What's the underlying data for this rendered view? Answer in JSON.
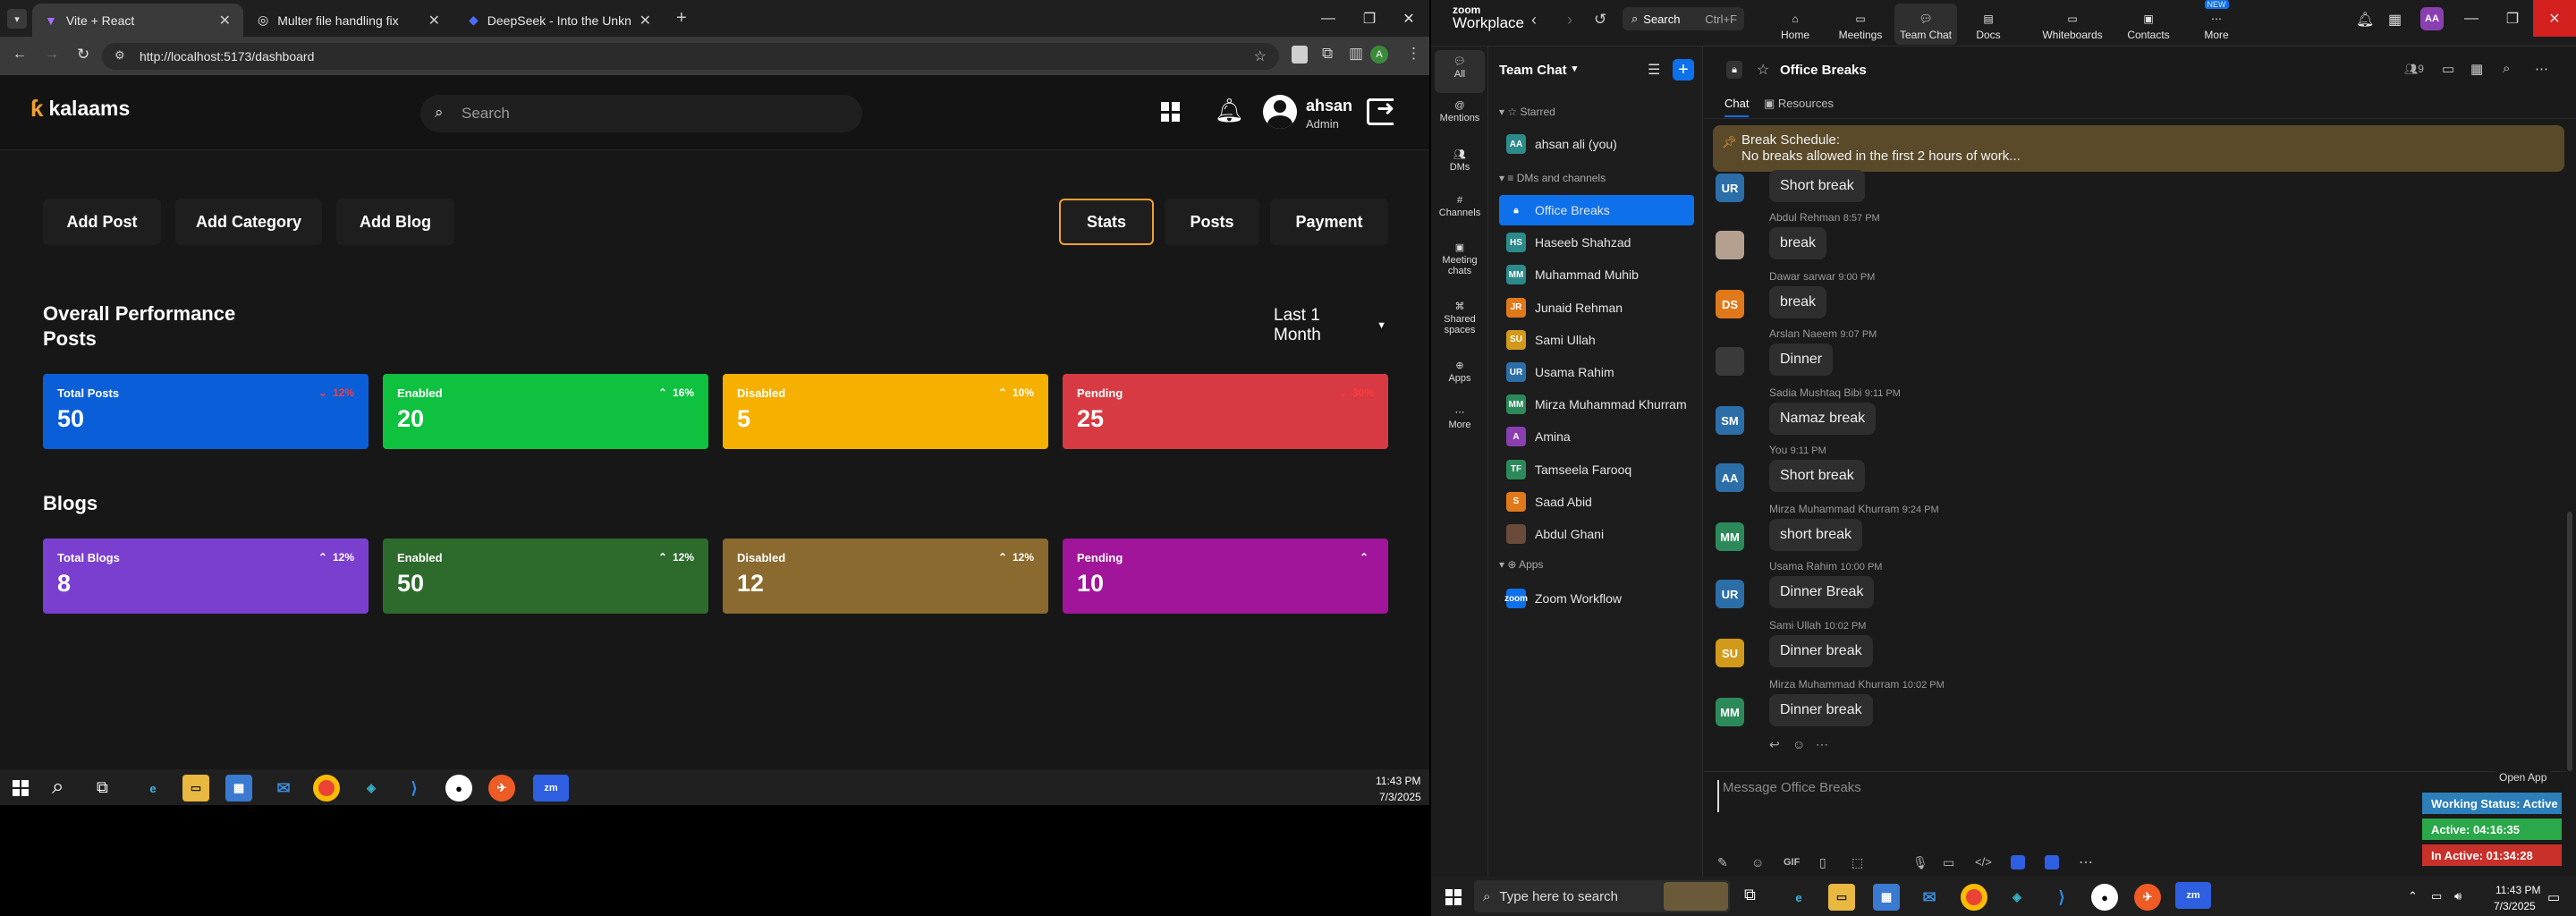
{
  "browser": {
    "tabs": [
      {
        "title": "Vite + React"
      },
      {
        "title": "Multer file handling fix"
      },
      {
        "title": "DeepSeek - Into the Unknown"
      }
    ],
    "url": "http://localhost:5173/dashboard"
  },
  "dashboard": {
    "logo": "kalaams",
    "search_placeholder": "Search",
    "user": {
      "name": "ahsan",
      "role": "Admin"
    },
    "nav_left": [
      "Add Post",
      "Add Category",
      "Add Blog"
    ],
    "nav_right": [
      "Stats",
      "Posts",
      "Payment"
    ],
    "section_title": "Overall Performance",
    "posts_title": "Posts",
    "range": "Last 1 Month",
    "post_cards": [
      {
        "label": "Total Posts",
        "value": "50",
        "change": "12%",
        "color": "#0a5fd8",
        "change_color": "#ff3b3b",
        "up": false
      },
      {
        "label": "Enabled",
        "value": "20",
        "change": "16%",
        "color": "#0ec13f",
        "change_color": "#ffffff",
        "up": true
      },
      {
        "label": "Disabled",
        "value": "5",
        "change": "10%",
        "color": "#f5b000",
        "change_color": "#ffffff",
        "up": true
      },
      {
        "label": "Pending",
        "value": "25",
        "change": "30%",
        "color": "#d83a44",
        "change_color": "#ff3b3b",
        "up": false
      }
    ],
    "blogs_title": "Blogs",
    "blog_cards": [
      {
        "label": "Total Blogs",
        "value": "8",
        "change": "12%",
        "color": "#7b3fd0",
        "change_color": "#ffffff",
        "up": true
      },
      {
        "label": "Enabled",
        "value": "50",
        "change": "12%",
        "color": "#2d6b2d",
        "change_color": "#ffffff",
        "up": true
      },
      {
        "label": "Disabled",
        "value": "12",
        "change": "12%",
        "color": "#8a6a2e",
        "change_color": "#ffffff",
        "up": true
      },
      {
        "label": "Pending",
        "value": "10",
        "change": "",
        "color": "#a0159a",
        "change_color": "#ffffff",
        "up": true
      }
    ],
    "taskbar_time": "11:43 PM",
    "taskbar_date": "7/3/2025"
  },
  "zoom": {
    "brand_top": "zoom",
    "brand": "Workplace",
    "search_label": "Search",
    "search_shortcut": "Ctrl+F",
    "top_tabs": [
      "Home",
      "Meetings",
      "Team Chat",
      "Docs",
      "Whiteboards",
      "Contacts",
      "More"
    ],
    "new_badge": "NEW",
    "user_initials": "AA",
    "rail": [
      "All",
      "Mentions",
      "DMs",
      "Channels",
      "Meeting chats",
      "Shared spaces",
      "Apps",
      "More"
    ],
    "list_title": "Team Chat",
    "starred_label": "Starred",
    "starred": [
      {
        "name": "ahsan ali (you)",
        "initials": "AA",
        "color": "#2c8a8a"
      }
    ],
    "dm_label": "DMs and channels",
    "dms": [
      {
        "name": "Office Breaks",
        "initials": "",
        "color": "#0e71eb"
      },
      {
        "name": "Haseeb Shahzad",
        "initials": "HS",
        "color": "#2c8a8a"
      },
      {
        "name": "Muhammad Muhib",
        "initials": "MM",
        "color": "#2c8a8a"
      },
      {
        "name": "Junaid Rehman",
        "initials": "JR",
        "color": "#e0791a"
      },
      {
        "name": "Sami Ullah",
        "initials": "SU",
        "color": "#d19a1a"
      },
      {
        "name": "Usama Rahim",
        "initials": "UR",
        "color": "#2c6fa8"
      },
      {
        "name": "Mirza Muhammad Khurram",
        "initials": "MM",
        "color": "#2c8a5a"
      },
      {
        "name": "Amina",
        "initials": "A",
        "color": "#8a3fb0"
      },
      {
        "name": "Tamseela Farooq",
        "initials": "TF",
        "color": "#2c8a5a"
      },
      {
        "name": "Saad Abid",
        "initials": "S",
        "color": "#e0791a"
      },
      {
        "name": "Abdul Ghani",
        "initials": "",
        "color": "#6a4a3a"
      }
    ],
    "apps_label": "Apps",
    "apps": [
      {
        "name": "Zoom Workflow",
        "initials": "zoom",
        "color": "#0e71eb"
      }
    ],
    "channel": "Office Breaks",
    "channel_tabs": [
      "Chat",
      "Resources"
    ],
    "member_count": "9",
    "pinned_title": "Break Schedule:",
    "pinned_text": "No breaks allowed in the first 2 hours of work...",
    "messages": [
      {
        "author": "",
        "time": "",
        "text": "Short break",
        "initials": "UR",
        "color": "#2c6fa8"
      },
      {
        "author": "Abdul Rehman",
        "time": "8:57 PM",
        "text": "break",
        "initials": "",
        "color": "#b5a090"
      },
      {
        "author": "Dawar sarwar",
        "time": "9:00 PM",
        "text": "break",
        "initials": "DS",
        "color": "#e0791a"
      },
      {
        "author": "Arslan Naeem",
        "time": "9:07 PM",
        "text": "Dinner",
        "initials": "",
        "color": "#3a3a3a"
      },
      {
        "author": "Sadia Mushtaq Bibi",
        "time": "9:11 PM",
        "text": "Namaz break",
        "initials": "SM",
        "color": "#2c6fa8"
      },
      {
        "author": "You",
        "time": "9:11 PM",
        "text": "Short break",
        "initials": "AA",
        "color": "#2c6fa8"
      },
      {
        "author": "Mirza Muhammad Khurram",
        "time": "9:24 PM",
        "text": "short break",
        "initials": "MM",
        "color": "#2c8a5a"
      },
      {
        "author": "Usama Rahim",
        "time": "10:00 PM",
        "text": "Dinner Break",
        "initials": "UR",
        "color": "#2c6fa8"
      },
      {
        "author": "Sami Ullah",
        "time": "10:02 PM",
        "text": "Dinner break",
        "initials": "SU",
        "color": "#d19a1a"
      },
      {
        "author": "Mirza Muhammad Khurram",
        "time": "10:02 PM",
        "text": "Dinner break",
        "initials": "MM",
        "color": "#2c8a5a"
      }
    ],
    "compose_placeholder": "Message Office Breaks",
    "open_app": "Open App",
    "status": [
      {
        "text": "Working Status: Active",
        "color": "#2c7fb8"
      },
      {
        "text": "Active: 04:16:35",
        "color": "#2aa84a"
      },
      {
        "text": "In Active: 01:34:28",
        "color": "#c8302a"
      }
    ],
    "taskbar_search": "Type here to search",
    "taskbar_time": "11:43 PM",
    "taskbar_date": "7/3/2025"
  }
}
